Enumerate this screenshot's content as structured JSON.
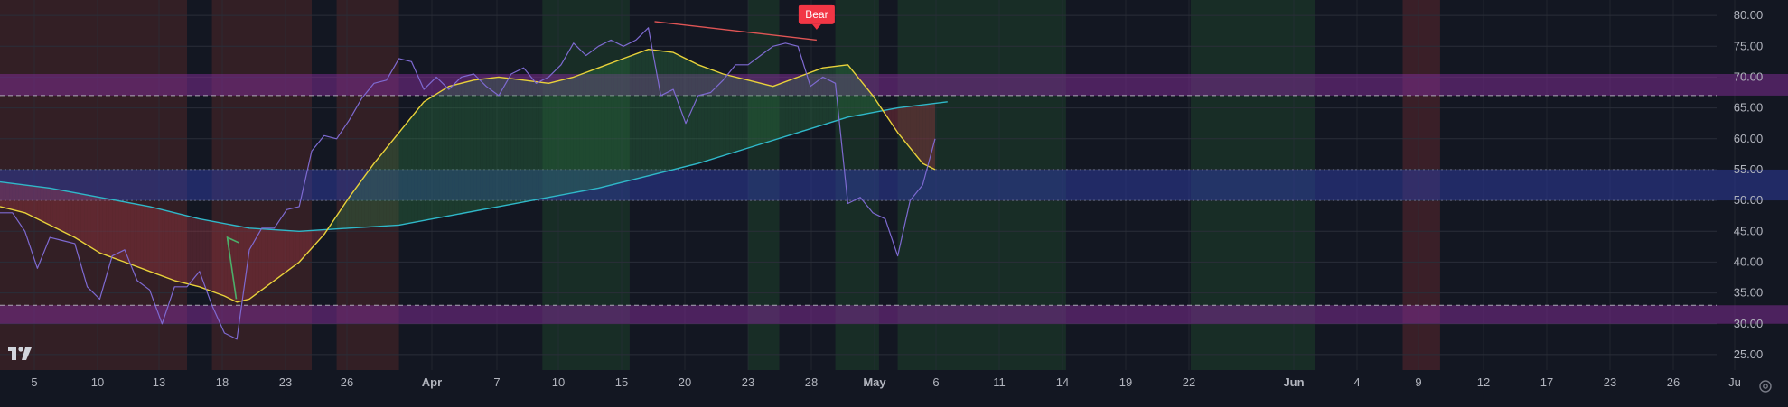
{
  "chart_data": {
    "type": "line",
    "x_axis_labels": [
      "5",
      "10",
      "13",
      "18",
      "23",
      "26",
      "Apr",
      "7",
      "10",
      "15",
      "20",
      "23",
      "28",
      "May",
      "6",
      "11",
      "14",
      "19",
      "22",
      "Jun",
      "4",
      "9",
      "12",
      "17",
      "23",
      "26",
      "Ju"
    ],
    "y_axis_labels": [
      "80.00",
      "75.00",
      "70.00",
      "65.00",
      "60.00",
      "55.00",
      "50.00",
      "45.00",
      "40.00",
      "35.00",
      "30.00",
      "25.00"
    ],
    "ylim": [
      22.5,
      82.5
    ],
    "grid": true,
    "levels": {
      "upper_dashed": 67,
      "lower_dashed": 33
    },
    "bands": [
      {
        "name": "overbought",
        "from": 67,
        "to": 70.5,
        "color": "#7b2b8f"
      },
      {
        "name": "midline",
        "from": 50,
        "to": 55,
        "color": "#2e3b9c"
      },
      {
        "name": "oversold",
        "from": 30,
        "to": 33,
        "color": "#7b2b8f"
      }
    ],
    "background_zones": [
      {
        "from": 0,
        "to": 30,
        "color": "#5a2a2a"
      },
      {
        "from": 34,
        "to": 50,
        "color": "#5a2a2a"
      },
      {
        "from": 54,
        "to": 64,
        "color": "#5a2a2a"
      },
      {
        "from": 87,
        "to": 101,
        "color": "#1f4a2c"
      },
      {
        "from": 120,
        "to": 125,
        "color": "#1f4a2c"
      },
      {
        "from": 134,
        "to": 141,
        "color": "#1f4a2c"
      },
      {
        "from": 144,
        "to": 171,
        "color": "#1f4a2c"
      },
      {
        "from": 191,
        "to": 211,
        "color": "#1f4a2c"
      },
      {
        "from": 225,
        "to": 231,
        "color": "#6a2a30"
      }
    ],
    "series": [
      {
        "key": "rsi",
        "color": "#7e6ad1",
        "points": [
          [
            0,
            48
          ],
          [
            2,
            48
          ],
          [
            4,
            45
          ],
          [
            6,
            39
          ],
          [
            8,
            44
          ],
          [
            10,
            43.5
          ],
          [
            12,
            43
          ],
          [
            14,
            36
          ],
          [
            16,
            34
          ],
          [
            18,
            41
          ],
          [
            20,
            42
          ],
          [
            22,
            37
          ],
          [
            24,
            35.5
          ],
          [
            26,
            30
          ],
          [
            28,
            36
          ],
          [
            30,
            36
          ],
          [
            32,
            38.5
          ],
          [
            34,
            33
          ],
          [
            36,
            28.5
          ],
          [
            38,
            27.5
          ],
          [
            40,
            42
          ],
          [
            42,
            45.5
          ],
          [
            44,
            45.5
          ],
          [
            46,
            48.5
          ],
          [
            48,
            49
          ],
          [
            50,
            58
          ],
          [
            52,
            60.5
          ],
          [
            54,
            60
          ],
          [
            56,
            63
          ],
          [
            58,
            66.5
          ],
          [
            60,
            69
          ],
          [
            62,
            69.5
          ],
          [
            64,
            73
          ],
          [
            66,
            72.5
          ],
          [
            68,
            68
          ],
          [
            70,
            70
          ],
          [
            72,
            68
          ],
          [
            74,
            70
          ],
          [
            76,
            70.5
          ],
          [
            78,
            68.5
          ],
          [
            80,
            67
          ],
          [
            82,
            70.5
          ],
          [
            84,
            71.5
          ],
          [
            86,
            69
          ],
          [
            88,
            70
          ],
          [
            90,
            72
          ],
          [
            92,
            75.5
          ],
          [
            94,
            73.5
          ],
          [
            96,
            75
          ],
          [
            98,
            76
          ],
          [
            100,
            75
          ],
          [
            102,
            76
          ],
          [
            104,
            78
          ],
          [
            106,
            67
          ],
          [
            108,
            68
          ],
          [
            110,
            62.5
          ],
          [
            112,
            67
          ],
          [
            114,
            67.5
          ],
          [
            116,
            69.5
          ],
          [
            118,
            72
          ],
          [
            120,
            72
          ],
          [
            122,
            73.5
          ],
          [
            124,
            75
          ],
          [
            126,
            75.5
          ],
          [
            128,
            75
          ],
          [
            130,
            68.5
          ],
          [
            132,
            70
          ],
          [
            134,
            69
          ],
          [
            136,
            49.5
          ],
          [
            138,
            50.5
          ],
          [
            140,
            48
          ],
          [
            142,
            47
          ],
          [
            144,
            41
          ],
          [
            146,
            50
          ],
          [
            148,
            52.5
          ],
          [
            150,
            60
          ]
        ]
      },
      {
        "key": "fast_ma",
        "color": "#e8d13a",
        "points": [
          [
            0,
            49
          ],
          [
            4,
            48
          ],
          [
            8,
            46
          ],
          [
            12,
            44
          ],
          [
            16,
            41.5
          ],
          [
            20,
            40
          ],
          [
            24,
            38.5
          ],
          [
            28,
            37
          ],
          [
            32,
            36
          ],
          [
            36,
            34.5
          ],
          [
            38,
            33.5
          ],
          [
            40,
            34
          ],
          [
            44,
            37
          ],
          [
            48,
            40
          ],
          [
            52,
            44.5
          ],
          [
            56,
            50.5
          ],
          [
            60,
            56
          ],
          [
            64,
            61
          ],
          [
            68,
            66
          ],
          [
            72,
            68.5
          ],
          [
            76,
            69.5
          ],
          [
            80,
            70
          ],
          [
            84,
            69.5
          ],
          [
            88,
            69
          ],
          [
            92,
            70
          ],
          [
            96,
            71.5
          ],
          [
            100,
            73
          ],
          [
            104,
            74.5
          ],
          [
            108,
            74
          ],
          [
            112,
            72
          ],
          [
            116,
            70.5
          ],
          [
            120,
            69.5
          ],
          [
            124,
            68.5
          ],
          [
            128,
            70
          ],
          [
            132,
            71.5
          ],
          [
            136,
            72
          ],
          [
            140,
            67
          ],
          [
            144,
            61
          ],
          [
            148,
            56
          ],
          [
            150,
            55
          ]
        ]
      },
      {
        "key": "slow_ma",
        "color": "#2fb8c9",
        "points": [
          [
            0,
            53
          ],
          [
            8,
            52
          ],
          [
            16,
            50.5
          ],
          [
            24,
            49
          ],
          [
            32,
            47
          ],
          [
            40,
            45.5
          ],
          [
            48,
            45
          ],
          [
            56,
            45.5
          ],
          [
            64,
            46
          ],
          [
            72,
            47.5
          ],
          [
            80,
            49
          ],
          [
            88,
            50.5
          ],
          [
            96,
            52
          ],
          [
            104,
            54
          ],
          [
            112,
            56
          ],
          [
            120,
            58.5
          ],
          [
            128,
            61
          ],
          [
            136,
            63.5
          ],
          [
            144,
            65
          ],
          [
            152,
            66
          ]
        ]
      }
    ],
    "fill_between": {
      "series_a": "fast_ma",
      "series_b": "slow_ma",
      "up_color": "#2e7d45",
      "down_color": "#b23a44"
    },
    "divergence_line": {
      "from": [
        105,
        79
      ],
      "to": [
        131,
        76
      ],
      "color": "#e05555"
    },
    "annotations": [
      {
        "label": "Bear",
        "x": 131,
        "y": 79,
        "color": "#f23645"
      }
    ],
    "arrow": {
      "from": [
        35,
        12
      ],
      "to": [
        34,
        6
      ],
      "color": "#4caf6a"
    }
  },
  "icons": {
    "logo": "tradingview-logo",
    "settings": "gear-icon"
  }
}
